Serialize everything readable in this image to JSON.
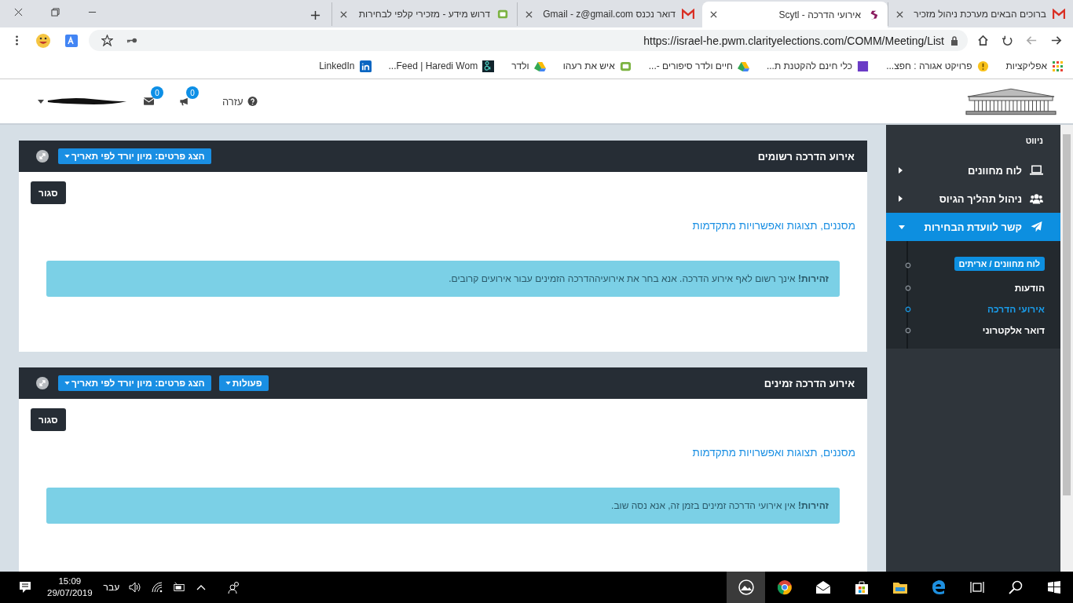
{
  "browser": {
    "tabs": [
      {
        "title": "ברוכים הבאים מערכת ניהול מזכיר",
        "kind": "mail",
        "selected": false
      },
      {
        "title": "אירועי הדרכה - Scytl",
        "kind": "scytl",
        "selected": true
      },
      {
        "title": "דואר נכנס Gmail - z@gmail.com",
        "kind": "mail",
        "selected": false
      },
      {
        "title": "דרוש מידע - מזכירי קלפי לבחירות",
        "kind": "netfree",
        "selected": false
      }
    ],
    "url": "https://israel-he.pwm.clarityelections.com/COMM/Meeting/List",
    "bookmarks": [
      {
        "label": "אפליקציות",
        "kind": "apps"
      },
      {
        "label": "פרויקט אגורה : חפצ...",
        "kind": "warning"
      },
      {
        "label": "כלי חינם להקטנת ת...",
        "kind": "square"
      },
      {
        "label": "חיים ולדר סיפורים -...",
        "kind": "drive"
      },
      {
        "label": "איש את רעהו",
        "kind": "netfree"
      },
      {
        "label": "ולדר",
        "kind": "drive"
      },
      {
        "label": "Feed | Haredi Wom...",
        "kind": "dark"
      },
      {
        "label": "LinkedIn",
        "kind": "linkedin"
      }
    ]
  },
  "header": {
    "help": "עזרה",
    "announcements_count": "0",
    "messages_count": "0"
  },
  "sidebar": {
    "heading": "ניווט",
    "items": [
      {
        "label": "לוח מחוונים",
        "kind": "laptop",
        "selected": false,
        "expanded": false
      },
      {
        "label": "ניהול תהליך הגיוס",
        "kind": "users",
        "selected": false,
        "expanded": false
      },
      {
        "label": "קשר לוועדת הבחירות",
        "kind": "plane",
        "selected": true,
        "expanded": true,
        "children": [
          {
            "label": "לוח מחוונים / אריתים",
            "kind": "badge",
            "selected": false
          },
          {
            "label": "הודעות",
            "kind": "link",
            "selected": false
          },
          {
            "label": "אירועי הדרכה",
            "kind": "link",
            "selected": true
          },
          {
            "label": "דואר אלקטרוני",
            "kind": "link",
            "selected": false
          }
        ]
      }
    ]
  },
  "panels": [
    {
      "title": "אירוע הדרכה רשומים",
      "sort_button": "הצג פרטים: מיון יורד לפי תאריך",
      "close_button": "סגור",
      "filters_link": "מסננים, תצוגות ואפשרויות מתקדמות",
      "alert": "**זהירות!** אינך רשום לאף אירוע הדרכה. אנא בחר את אירועיההדרכה הזמינים עבור אירועים קרובים."
    },
    {
      "title": "אירוע הדרכה זמינים",
      "actions_button": "פעולות",
      "sort_button": "הצג פרטים: מיון יורד לפי תאריך",
      "close_button": "סגור",
      "filters_link": "מסננים, תצוגות ואפשרויות מתקדמות",
      "alert": "**זהירות!** אין אירועי הדרכה זמינים בזמן זה, אנא נסה שוב."
    }
  ],
  "taskbar": {
    "time": "15:09",
    "date": "29/07/2019",
    "language": "עבר"
  }
}
